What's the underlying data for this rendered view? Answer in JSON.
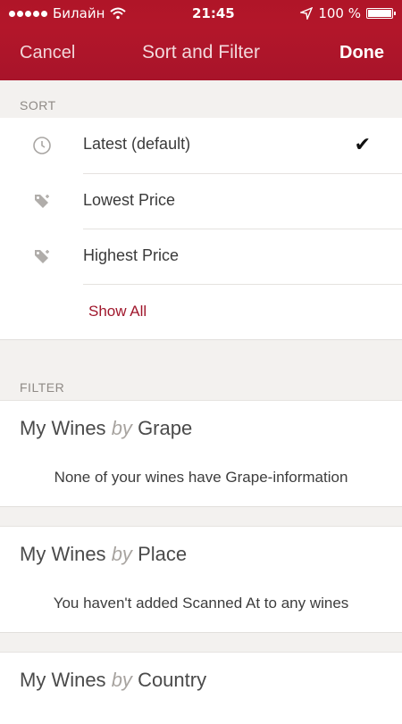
{
  "status_bar": {
    "carrier": "Билайн",
    "time": "21:45",
    "battery": "100 %"
  },
  "navbar": {
    "cancel": "Cancel",
    "title": "Sort and Filter",
    "done": "Done"
  },
  "sort": {
    "header": "SORT",
    "options": [
      {
        "label": "Latest (default)",
        "icon": "clock-icon",
        "selected": true
      },
      {
        "label": "Lowest Price",
        "icon": "price-tag-icon",
        "selected": false
      },
      {
        "label": "Highest Price",
        "icon": "price-tag-icon",
        "selected": false
      }
    ],
    "show_all": "Show All"
  },
  "filter": {
    "header": "FILTER",
    "by_word": "by",
    "groups": [
      {
        "prefix": "My Wines",
        "name": "Grape",
        "message": "None of your wines have Grape-information"
      },
      {
        "prefix": "My Wines",
        "name": "Place",
        "message": "You haven't added Scanned At to any wines"
      },
      {
        "prefix": "My Wines",
        "name": "Country",
        "message": ""
      }
    ]
  },
  "colors": {
    "brand": "#b3162a",
    "accent_text": "#a0172c",
    "background": "#f3f1ef"
  }
}
